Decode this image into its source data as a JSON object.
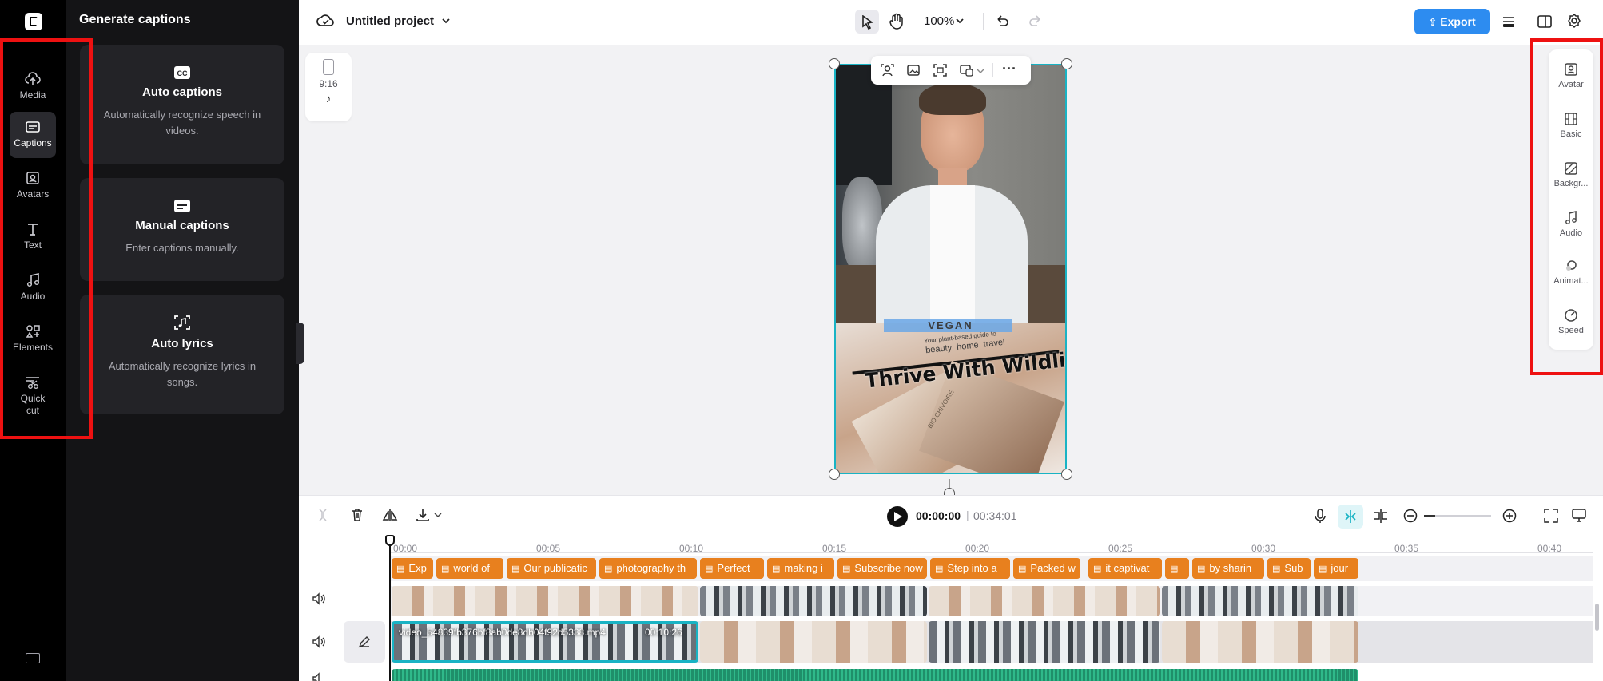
{
  "nav": {
    "items": [
      {
        "label": "Media",
        "icon": "cloud-upload-icon"
      },
      {
        "label": "Captions",
        "icon": "captions-icon"
      },
      {
        "label": "Avatars",
        "icon": "avatar-icon"
      },
      {
        "label": "Text",
        "icon": "text-icon"
      },
      {
        "label": "Audio",
        "icon": "music-note-icon"
      },
      {
        "label": "Elements",
        "icon": "elements-icon"
      },
      {
        "label": "Quick cut",
        "icon": "scissors-icon"
      }
    ],
    "active": "Captions"
  },
  "panel": {
    "title": "Generate captions",
    "cards": [
      {
        "title": "Auto captions",
        "desc": "Automatically recognize speech in videos."
      },
      {
        "title": "Manual captions",
        "desc": "Enter captions manually."
      },
      {
        "title": "Auto lyrics",
        "desc": "Automatically recognize lyrics in songs."
      }
    ]
  },
  "header": {
    "project_name": "Untitled project",
    "zoom": "100%",
    "export_label": "Export"
  },
  "canvas": {
    "ratio_label": "9:16",
    "overlay_top_text": "VEGAN",
    "overlay_sub_text": "Your plant-based guide to",
    "overlay_words": [
      "beauty",
      "home",
      "travel"
    ],
    "headline": "Thrive With Wildlife",
    "brand_print": "BIO CHIVOIRE"
  },
  "right_panel": {
    "items": [
      {
        "label": "Avatar",
        "icon": "avatar-icon"
      },
      {
        "label": "Basic",
        "icon": "film-icon"
      },
      {
        "label": "Backgr...",
        "icon": "background-icon"
      },
      {
        "label": "Audio",
        "icon": "music-note-icon"
      },
      {
        "label": "Animat...",
        "icon": "animation-icon"
      },
      {
        "label": "Speed",
        "icon": "speed-icon"
      }
    ]
  },
  "playback": {
    "current": "00:00:00",
    "separator": "|",
    "total": "00:34:01"
  },
  "timeline": {
    "ticks": [
      "00:00",
      "00:05",
      "00:10",
      "00:15",
      "00:20",
      "00:25",
      "00:30",
      "00:35",
      "00:40"
    ],
    "captions": [
      "Exp",
      "world of",
      "Our publicatic",
      "photography th",
      "Perfect",
      "making i",
      "Subscribe now",
      "Step into a",
      "Packed w",
      "it captivat",
      "",
      "by sharin",
      "Sub",
      "jour"
    ],
    "main_clip_name": "video_54839fb376bf8ab0de8db04f92d5338.mp4",
    "main_clip_duration": "00:10:26"
  },
  "colors": {
    "accent": "#2d8cf0",
    "caption": "#e8801e",
    "highlight": "#ee1111",
    "selection": "#19b3c4"
  }
}
